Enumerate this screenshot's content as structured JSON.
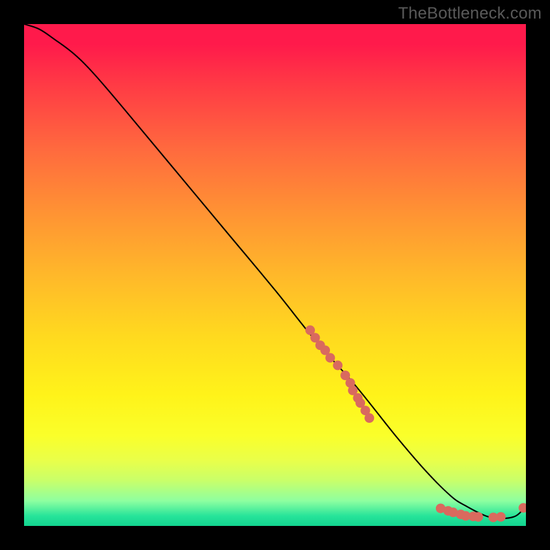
{
  "watermark": "TheBottleneck.com",
  "chart_data": {
    "type": "line",
    "title": "",
    "xlabel": "",
    "ylabel": "",
    "xlim": [
      0,
      100
    ],
    "ylim": [
      0,
      100
    ],
    "grid": false,
    "background_gradient": {
      "orientation": "vertical",
      "stops": [
        {
          "pos": 0.0,
          "color": "#ff1a4b"
        },
        {
          "pos": 0.5,
          "color": "#ffb82a"
        },
        {
          "pos": 0.8,
          "color": "#faff2a"
        },
        {
          "pos": 0.96,
          "color": "#8effa0"
        },
        {
          "pos": 1.0,
          "color": "#12d48f"
        }
      ]
    },
    "series": [
      {
        "name": "bottleneck-curve",
        "color": "#000000",
        "x": [
          0,
          3,
          6,
          10,
          14,
          20,
          30,
          40,
          50,
          58,
          66,
          74,
          80,
          85,
          88,
          92,
          95,
          98,
          100
        ],
        "y": [
          100,
          99,
          97,
          94,
          90,
          83,
          71,
          59,
          47,
          37,
          28,
          18,
          11,
          6,
          4,
          2,
          1.5,
          2,
          4
        ]
      }
    ],
    "markers": {
      "name": "highlight-dots",
      "color": "#d96a5e",
      "radius_px": 7,
      "points": [
        {
          "x": 57,
          "y": 39
        },
        {
          "x": 58,
          "y": 37.5
        },
        {
          "x": 59,
          "y": 36
        },
        {
          "x": 60,
          "y": 35
        },
        {
          "x": 61,
          "y": 33.5
        },
        {
          "x": 62.5,
          "y": 32
        },
        {
          "x": 64,
          "y": 30
        },
        {
          "x": 65,
          "y": 28.5
        },
        {
          "x": 65.5,
          "y": 27
        },
        {
          "x": 66.5,
          "y": 25.5
        },
        {
          "x": 67,
          "y": 24.5
        },
        {
          "x": 68,
          "y": 23
        },
        {
          "x": 68.8,
          "y": 21.5
        },
        {
          "x": 83,
          "y": 3.5
        },
        {
          "x": 84.5,
          "y": 3
        },
        {
          "x": 85.5,
          "y": 2.7
        },
        {
          "x": 87,
          "y": 2.3
        },
        {
          "x": 88,
          "y": 2
        },
        {
          "x": 89.5,
          "y": 1.9
        },
        {
          "x": 90.5,
          "y": 1.8
        },
        {
          "x": 93.5,
          "y": 1.7
        },
        {
          "x": 95,
          "y": 1.8
        },
        {
          "x": 99.5,
          "y": 3.6
        }
      ]
    }
  }
}
